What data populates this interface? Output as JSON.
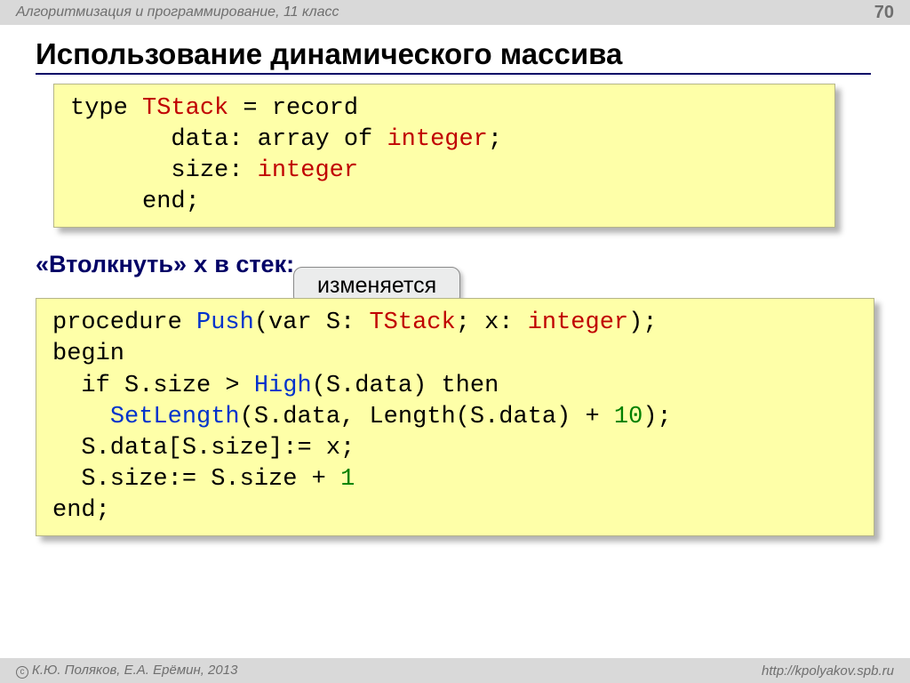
{
  "header": {
    "subject": "Алгоритмизация и программирование, 11 класс",
    "page": "70"
  },
  "title": "Использование динамического массива",
  "code1": {
    "t1a": "type ",
    "t1b": "TStack",
    "t1c": " = record",
    "t2a": "       data: array of ",
    "t2b": "integer",
    "t2c": ";",
    "t3a": "       size: ",
    "t3b": "integer",
    "t4": "     end;"
  },
  "subhead": {
    "p1": "«Втолкнуть» ",
    "p2": "x",
    "p3": " в стек:"
  },
  "callout": "изменяется",
  "code2": {
    "l1a": "procedure ",
    "l1b": "Push",
    "l1c": "(var S: ",
    "l1d": "TStack",
    "l1e": "; x: ",
    "l1f": "integer",
    "l1g": ");",
    "l2": "begin",
    "l3a": "  if S.size > ",
    "l3b": "High",
    "l3c": "(S.data) then",
    "l4a": "    ",
    "l4b": "SetLength",
    "l4c": "(S.data, Length(S.data) + ",
    "l4d": "10",
    "l4e": ");",
    "l5": "  S.data[S.size]:= x;",
    "l6a": "  S.size:= S.size + ",
    "l6b": "1",
    "l7": "end;"
  },
  "footer": {
    "left": "К.Ю. Поляков, Е.А. Ерёмин, 2013",
    "right": "http://kpolyakov.spb.ru"
  }
}
